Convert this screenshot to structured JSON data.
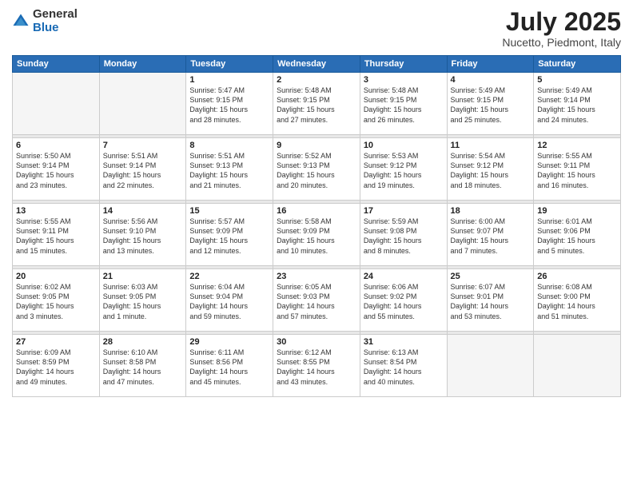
{
  "logo": {
    "general": "General",
    "blue": "Blue"
  },
  "title": "July 2025",
  "location": "Nucetto, Piedmont, Italy",
  "weekdays": [
    "Sunday",
    "Monday",
    "Tuesday",
    "Wednesday",
    "Thursday",
    "Friday",
    "Saturday"
  ],
  "weeks": [
    [
      {
        "day": "",
        "info": ""
      },
      {
        "day": "",
        "info": ""
      },
      {
        "day": "1",
        "info": "Sunrise: 5:47 AM\nSunset: 9:15 PM\nDaylight: 15 hours\nand 28 minutes."
      },
      {
        "day": "2",
        "info": "Sunrise: 5:48 AM\nSunset: 9:15 PM\nDaylight: 15 hours\nand 27 minutes."
      },
      {
        "day": "3",
        "info": "Sunrise: 5:48 AM\nSunset: 9:15 PM\nDaylight: 15 hours\nand 26 minutes."
      },
      {
        "day": "4",
        "info": "Sunrise: 5:49 AM\nSunset: 9:15 PM\nDaylight: 15 hours\nand 25 minutes."
      },
      {
        "day": "5",
        "info": "Sunrise: 5:49 AM\nSunset: 9:14 PM\nDaylight: 15 hours\nand 24 minutes."
      }
    ],
    [
      {
        "day": "6",
        "info": "Sunrise: 5:50 AM\nSunset: 9:14 PM\nDaylight: 15 hours\nand 23 minutes."
      },
      {
        "day": "7",
        "info": "Sunrise: 5:51 AM\nSunset: 9:14 PM\nDaylight: 15 hours\nand 22 minutes."
      },
      {
        "day": "8",
        "info": "Sunrise: 5:51 AM\nSunset: 9:13 PM\nDaylight: 15 hours\nand 21 minutes."
      },
      {
        "day": "9",
        "info": "Sunrise: 5:52 AM\nSunset: 9:13 PM\nDaylight: 15 hours\nand 20 minutes."
      },
      {
        "day": "10",
        "info": "Sunrise: 5:53 AM\nSunset: 9:12 PM\nDaylight: 15 hours\nand 19 minutes."
      },
      {
        "day": "11",
        "info": "Sunrise: 5:54 AM\nSunset: 9:12 PM\nDaylight: 15 hours\nand 18 minutes."
      },
      {
        "day": "12",
        "info": "Sunrise: 5:55 AM\nSunset: 9:11 PM\nDaylight: 15 hours\nand 16 minutes."
      }
    ],
    [
      {
        "day": "13",
        "info": "Sunrise: 5:55 AM\nSunset: 9:11 PM\nDaylight: 15 hours\nand 15 minutes."
      },
      {
        "day": "14",
        "info": "Sunrise: 5:56 AM\nSunset: 9:10 PM\nDaylight: 15 hours\nand 13 minutes."
      },
      {
        "day": "15",
        "info": "Sunrise: 5:57 AM\nSunset: 9:09 PM\nDaylight: 15 hours\nand 12 minutes."
      },
      {
        "day": "16",
        "info": "Sunrise: 5:58 AM\nSunset: 9:09 PM\nDaylight: 15 hours\nand 10 minutes."
      },
      {
        "day": "17",
        "info": "Sunrise: 5:59 AM\nSunset: 9:08 PM\nDaylight: 15 hours\nand 8 minutes."
      },
      {
        "day": "18",
        "info": "Sunrise: 6:00 AM\nSunset: 9:07 PM\nDaylight: 15 hours\nand 7 minutes."
      },
      {
        "day": "19",
        "info": "Sunrise: 6:01 AM\nSunset: 9:06 PM\nDaylight: 15 hours\nand 5 minutes."
      }
    ],
    [
      {
        "day": "20",
        "info": "Sunrise: 6:02 AM\nSunset: 9:05 PM\nDaylight: 15 hours\nand 3 minutes."
      },
      {
        "day": "21",
        "info": "Sunrise: 6:03 AM\nSunset: 9:05 PM\nDaylight: 15 hours\nand 1 minute."
      },
      {
        "day": "22",
        "info": "Sunrise: 6:04 AM\nSunset: 9:04 PM\nDaylight: 14 hours\nand 59 minutes."
      },
      {
        "day": "23",
        "info": "Sunrise: 6:05 AM\nSunset: 9:03 PM\nDaylight: 14 hours\nand 57 minutes."
      },
      {
        "day": "24",
        "info": "Sunrise: 6:06 AM\nSunset: 9:02 PM\nDaylight: 14 hours\nand 55 minutes."
      },
      {
        "day": "25",
        "info": "Sunrise: 6:07 AM\nSunset: 9:01 PM\nDaylight: 14 hours\nand 53 minutes."
      },
      {
        "day": "26",
        "info": "Sunrise: 6:08 AM\nSunset: 9:00 PM\nDaylight: 14 hours\nand 51 minutes."
      }
    ],
    [
      {
        "day": "27",
        "info": "Sunrise: 6:09 AM\nSunset: 8:59 PM\nDaylight: 14 hours\nand 49 minutes."
      },
      {
        "day": "28",
        "info": "Sunrise: 6:10 AM\nSunset: 8:58 PM\nDaylight: 14 hours\nand 47 minutes."
      },
      {
        "day": "29",
        "info": "Sunrise: 6:11 AM\nSunset: 8:56 PM\nDaylight: 14 hours\nand 45 minutes."
      },
      {
        "day": "30",
        "info": "Sunrise: 6:12 AM\nSunset: 8:55 PM\nDaylight: 14 hours\nand 43 minutes."
      },
      {
        "day": "31",
        "info": "Sunrise: 6:13 AM\nSunset: 8:54 PM\nDaylight: 14 hours\nand 40 minutes."
      },
      {
        "day": "",
        "info": ""
      },
      {
        "day": "",
        "info": ""
      }
    ]
  ]
}
